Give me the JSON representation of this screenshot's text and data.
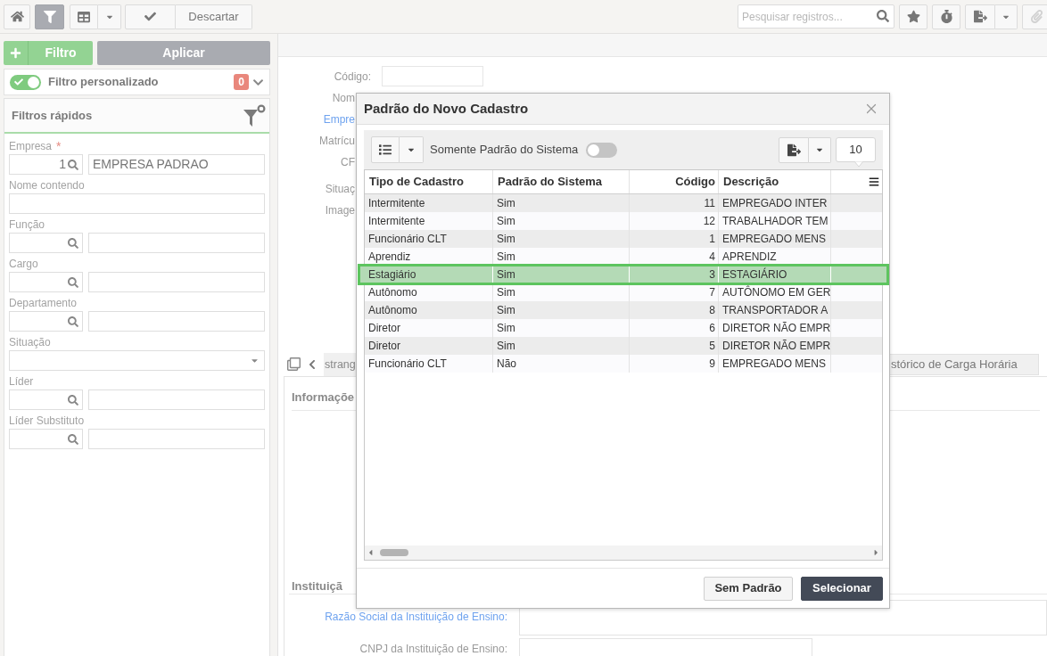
{
  "toolbar": {
    "buttons": [
      {
        "kind": "home",
        "selected": false
      },
      {
        "kind": "filter",
        "selected": true
      }
    ],
    "discard_button": "Descartar",
    "search": {
      "placeholder": "Pesquisar registros..."
    },
    "right_buttons": [
      {
        "kind": "star",
        "disabled": false
      },
      {
        "kind": "timer",
        "disabled": false
      },
      {
        "kind": "export",
        "disabled": false
      },
      {
        "kind": "attach",
        "disabled": true
      }
    ]
  },
  "filter_panel": {
    "add_button": "Filtro",
    "apply_button": "Aplicar",
    "custom_filter": {
      "label": "Filtro personalizado",
      "on": true,
      "count": "0"
    },
    "quick_filters": {
      "title": "Filtros rápidos",
      "fields": [
        {
          "kind": "lookup",
          "label": "Empresa",
          "required_mark": "*",
          "code": "1",
          "description": "EMPRESA PADRAO"
        },
        {
          "kind": "text",
          "label": "Nome contendo"
        },
        {
          "kind": "lookup",
          "label": "Função"
        },
        {
          "kind": "lookup",
          "label": "Cargo"
        },
        {
          "kind": "lookup",
          "label": "Departamento"
        },
        {
          "kind": "select",
          "label": "Situação"
        },
        {
          "kind": "lookup",
          "label": "Líder"
        },
        {
          "kind": "lookup",
          "label": "Líder Substituto"
        }
      ]
    }
  },
  "record_form": {
    "fields": [
      {
        "label": "Código:",
        "kind": "input",
        "highlighted": false
      },
      {
        "label": "Nom",
        "kind": "label",
        "highlighted": false
      },
      {
        "label": "Empre",
        "kind": "label",
        "highlighted": true
      },
      {
        "label": "Matrícu",
        "kind": "label",
        "highlighted": false
      },
      {
        "label": "CF",
        "kind": "label",
        "highlighted": false
      },
      {
        "label": "Situaç",
        "kind": "label",
        "highlighted": false
      },
      {
        "label": "Image",
        "kind": "label",
        "highlighted": false
      }
    ],
    "tabs": [
      {
        "label": "strang"
      },
      {
        "label": "stórico de Carga Horária"
      }
    ],
    "sections": [
      {
        "title": "Informaçõe"
      },
      {
        "title": "Instituiçã",
        "fields": [
          {
            "label": "Razão Social da Instituição de Ensino:",
            "kind": "textarea",
            "highlighted": true
          },
          {
            "label": "CNPJ da Instituição de Ensino:",
            "kind": "input",
            "highlighted": false
          }
        ]
      }
    ]
  },
  "modal": {
    "title": "Padrão do Novo Cadastro",
    "toolbar": {
      "toggle": {
        "label": "Somente Padrão do Sistema",
        "on": false
      },
      "page_size": "10"
    },
    "table": {
      "columns": [
        {
          "label": "Tipo de Cadastro",
          "kind": "text"
        },
        {
          "label": "Padrão do Sistema",
          "kind": "text"
        },
        {
          "label": "Código",
          "kind": "number"
        },
        {
          "label": "Descrição",
          "kind": "text"
        }
      ],
      "rows": [
        {
          "cells": [
            "Intermitente",
            "Sim",
            "11",
            "EMPREGADO INTER"
          ],
          "selected": false
        },
        {
          "cells": [
            "Intermitente",
            "Sim",
            "12",
            "TRABALHADOR TEM"
          ],
          "selected": false
        },
        {
          "cells": [
            "Funcionário CLT",
            "Sim",
            "1",
            "EMPREGADO MENS"
          ],
          "selected": false
        },
        {
          "cells": [
            "Aprendiz",
            "Sim",
            "4",
            "APRENDIZ"
          ],
          "selected": false
        },
        {
          "cells": [
            "Estagiário",
            "Sim",
            "3",
            "ESTAGIÁRIO"
          ],
          "selected": true
        },
        {
          "cells": [
            "Autônomo",
            "Sim",
            "7",
            "AUTÔNOMO EM GER"
          ],
          "selected": false
        },
        {
          "cells": [
            "Autônomo",
            "Sim",
            "8",
            "TRANSPORTADOR A"
          ],
          "selected": false
        },
        {
          "cells": [
            "Diretor",
            "Sim",
            "6",
            "DIRETOR NÃO EMPR"
          ],
          "selected": false
        },
        {
          "cells": [
            "Diretor",
            "Sim",
            "5",
            "DIRETOR NÃO EMPR"
          ],
          "selected": false
        },
        {
          "cells": [
            "Funcionário CLT",
            "Não",
            "9",
            "EMPREGADO MENS"
          ],
          "selected": false
        }
      ]
    },
    "buttons": [
      {
        "label": "Sem Padrão",
        "kind": "secondary"
      },
      {
        "label": "Selecionar",
        "kind": "primary"
      }
    ]
  }
}
